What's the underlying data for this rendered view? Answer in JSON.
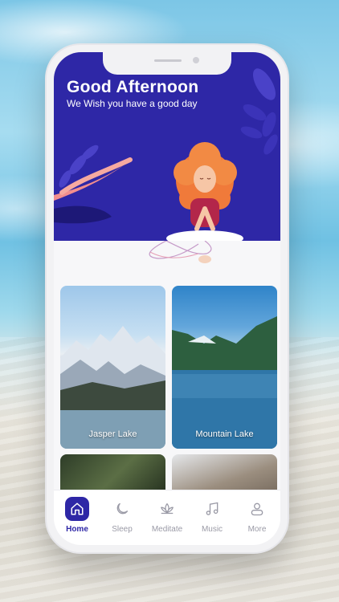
{
  "header": {
    "greeting": "Good Afternoon",
    "subtitle": "We Wish you have a good day"
  },
  "cards": [
    {
      "label": "Jasper Lake"
    },
    {
      "label": "Mountain Lake"
    },
    {
      "label": ""
    },
    {
      "label": ""
    }
  ],
  "nav": {
    "items": [
      {
        "label": "Home",
        "icon": "home-icon",
        "active": true
      },
      {
        "label": "Sleep",
        "icon": "moon-icon",
        "active": false
      },
      {
        "label": "Meditate",
        "icon": "lotus-icon",
        "active": false
      },
      {
        "label": "Music",
        "icon": "music-note-icon",
        "active": false
      },
      {
        "label": "More",
        "icon": "user-icon",
        "active": false
      }
    ]
  },
  "colors": {
    "primary": "#2e27a6",
    "accent_leaf": "#f28e8e",
    "hair": "#f07a3a",
    "nav_inactive": "#9a9aa6"
  }
}
